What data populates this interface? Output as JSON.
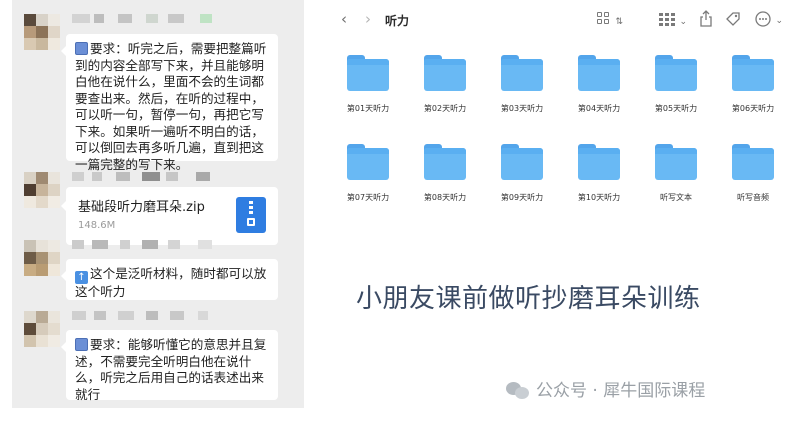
{
  "chat": {
    "messages": [
      {
        "type": "text",
        "emoji": "book-emoji",
        "text": "要求：听完之后，需要把整篇听到的内容全部写下来，并且能够明白他在说什么，里面不会的生词都要查出来。然后，在听的过程中，可以听一句，暂停一句，再把它写下来。如果听一遍听不明白的话，可以倒回去再多听几遍，直到把这一篇完整的写下来。"
      },
      {
        "type": "file",
        "file_name": "基础段听力磨耳朵.zip",
        "file_size": "148.6M",
        "icon": "zip-file-icon"
      },
      {
        "type": "text",
        "emoji": "up-arrow-emoji",
        "text": "这个是泛听材料，随时都可以放这个听力"
      },
      {
        "type": "text",
        "emoji": "book-emoji",
        "text": "要求：能够听懂它的意思并且复述，不需要完全听明白他在说什么，听完之后用自己的话表述出来就行"
      }
    ]
  },
  "finder": {
    "title": "听力",
    "folders": [
      "第01天听力",
      "第02天听力",
      "第03天听力",
      "第04天听力",
      "第05天听力",
      "第06天听力",
      "第07天听力",
      "第08天听力",
      "第09天听力",
      "第10天听力",
      "听写文本",
      "听写音频"
    ],
    "folder_color": "#69b9f4"
  },
  "caption": "小朋友课前做听抄磨耳朵训练",
  "watermark": "公众号 · 犀牛国际课程"
}
